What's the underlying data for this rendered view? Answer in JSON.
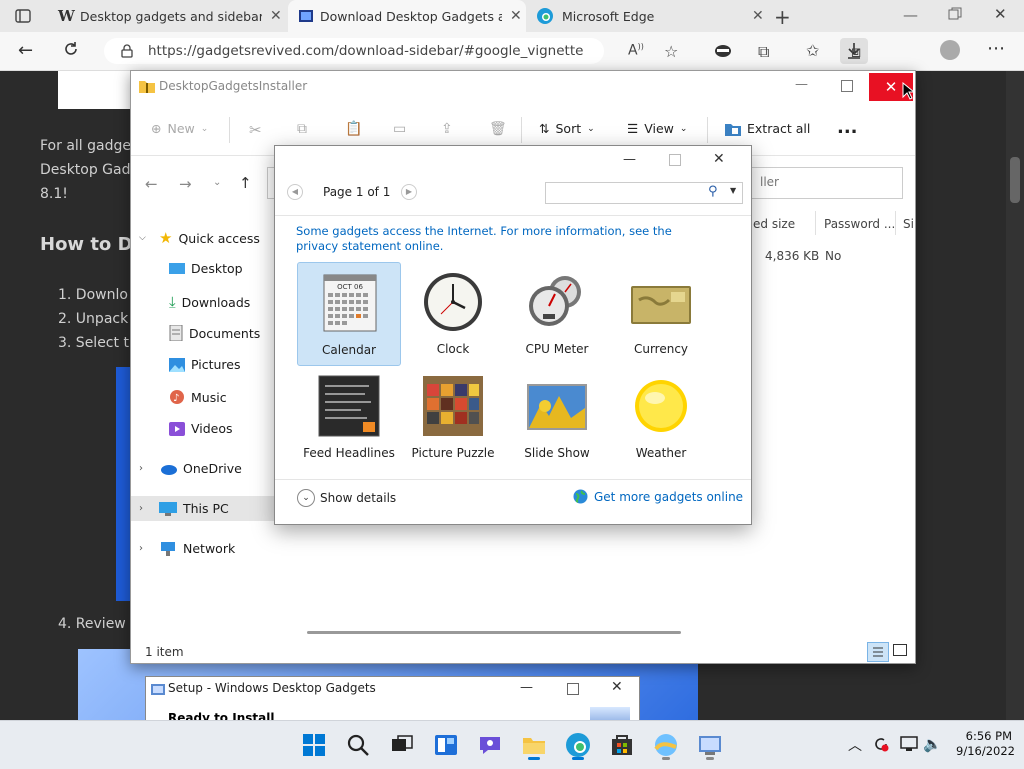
{
  "browser": {
    "tabs": [
      {
        "title": "Desktop gadgets and sidebar for",
        "active": false
      },
      {
        "title": "Download Desktop Gadgets and",
        "active": true
      },
      {
        "title": "Microsoft Edge",
        "active": false
      }
    ],
    "url": "https://gadgetsrevived.com/download-sidebar/#google_vignette"
  },
  "page": {
    "para1": [
      "For all gadge",
      "Desktop Gad",
      "8.1!"
    ],
    "heading": "How to D",
    "steps": [
      "1. Downlo",
      "2. Unpack",
      "3. Select t"
    ],
    "step4": "4. Review"
  },
  "explorer": {
    "title": "DesktopGadgetsInstaller",
    "toolbar": {
      "new": "New",
      "sort": "Sort",
      "view": "View",
      "extract": "Extract all",
      "more": "..."
    },
    "search_placeholder": "ller",
    "columns": [
      "ed size",
      "Password ...",
      "Si"
    ],
    "row": {
      "size": "4,836 KB",
      "password": "No"
    },
    "nav": {
      "quick_access": "Quick access",
      "desktop": "Desktop",
      "downloads": "Downloads",
      "documents": "Documents",
      "pictures": "Pictures",
      "music": "Music",
      "videos": "Videos",
      "onedrive": "OneDrive",
      "this_pc": "This PC",
      "network": "Network"
    },
    "status": "1 item"
  },
  "gadgets": {
    "page_label": "Page 1 of 1",
    "info": "Some gadgets access the Internet.  For more information, see the privacy statement online.",
    "items": [
      "Calendar",
      "Clock",
      "CPU Meter",
      "Currency",
      "Feed Headlines",
      "Picture Puzzle",
      "Slide Show",
      "Weather"
    ],
    "calendar_month": "OCT 06",
    "show_details": "Show details",
    "get_more": "Get more gadgets online"
  },
  "setup": {
    "title": "Setup - Windows Desktop Gadgets",
    "subtitle": "Ready to Install"
  },
  "taskbar": {
    "time": "6:56 PM",
    "date": "9/16/2022"
  },
  "colors": {
    "accent": "#0067c0",
    "close_red": "#e81123",
    "page_bg": "#2b2b2b",
    "link": "#0066cc"
  }
}
